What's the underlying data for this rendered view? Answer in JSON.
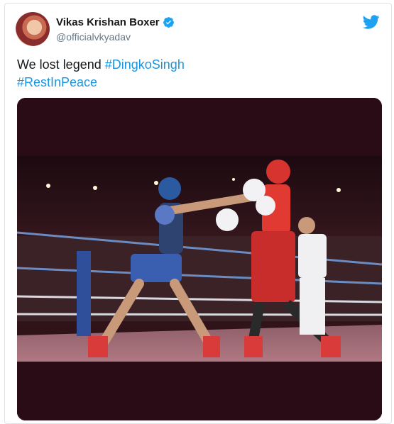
{
  "author": {
    "name": "Vikas Krishan Boxer",
    "handle": "@officialvkyadav",
    "verified": true
  },
  "tweet": {
    "text_plain": "We lost legend ",
    "hashtag1": "#DingkoSingh",
    "hashtag2": "#RestInPeace"
  },
  "icons": {
    "avatar": "avatar-photo",
    "verified": "verified-badge-icon",
    "brand": "twitter-bird-icon"
  },
  "colors": {
    "link": "#1b95e0",
    "twitter_blue": "#1da1f2",
    "name": "#14171a",
    "handle": "#657786"
  }
}
